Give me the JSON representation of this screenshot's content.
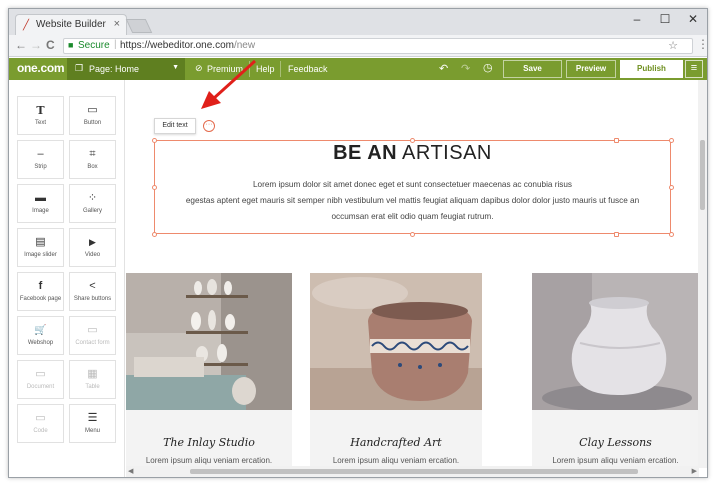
{
  "browser": {
    "tab_title": "Website Builder",
    "tab_close": "×",
    "minimize": "–",
    "maximize": "☐",
    "close": "✕",
    "back": "←",
    "forward": "→",
    "reload": "C",
    "secure_label": "Secure",
    "url_scheme": "https://",
    "url_host": "webeditor.one.com",
    "url_path": "/new",
    "star": "☆",
    "menu": "⋮"
  },
  "builder_bar": {
    "logo": "one.com",
    "page_selector": "Page: Home",
    "premium": "Premium",
    "help": "Help",
    "feedback": "Feedback",
    "save": "Save",
    "preview": "Preview",
    "publish": "Publish",
    "colors": {
      "bar": "#7a9c2f",
      "page_selector": "#5f7f20"
    }
  },
  "elements_panel": {
    "tiles": [
      {
        "label": "Text",
        "icon": "T"
      },
      {
        "label": "Button",
        "icon": "▭"
      },
      {
        "label": "Strip",
        "icon": "–"
      },
      {
        "label": "Box",
        "icon": "⌗"
      },
      {
        "label": "Image",
        "icon": "▬"
      },
      {
        "label": "Gallery",
        "icon": "⁘"
      },
      {
        "label": "Image slider",
        "icon": "▤"
      },
      {
        "label": "Video",
        "icon": "▶"
      },
      {
        "label": "Facebook page",
        "icon": "f"
      },
      {
        "label": "Share buttons",
        "icon": "<"
      },
      {
        "label": "Webshop",
        "icon": "🛒"
      },
      {
        "label": "Contact form",
        "icon": "▭"
      },
      {
        "label": "Document",
        "icon": "▭"
      },
      {
        "label": "Table",
        "icon": "▦"
      },
      {
        "label": "Code",
        "icon": "▭"
      },
      {
        "label": "Menu",
        "icon": "☰"
      }
    ]
  },
  "canvas": {
    "edit_text_button": "Edit text",
    "more_button": "···",
    "headline_bold": "BE AN",
    "headline_light": "ARTISAN",
    "body_lines": [
      "Lorem ipsum dolor sit amet donec eget et sunt consectetuer maecenas ac conubia risus",
      "egestas aptent eget mauris sit semper nibh vestibulum vel mattis feugiat aliquam dapibus dolor dolor justo mauris ut fusce an",
      "occumsan erat elit odio quam feugiat rutrum."
    ],
    "cards": [
      {
        "title": "The Inlay Studio",
        "text": "Lorem ipsum aliqu veniam ercation."
      },
      {
        "title": "Handcrafted Art",
        "text": "Lorem ipsum aliqu veniam ercation."
      },
      {
        "title": "Clay Lessons",
        "text": "Lorem ipsum aliqu veniam ercation."
      }
    ]
  }
}
